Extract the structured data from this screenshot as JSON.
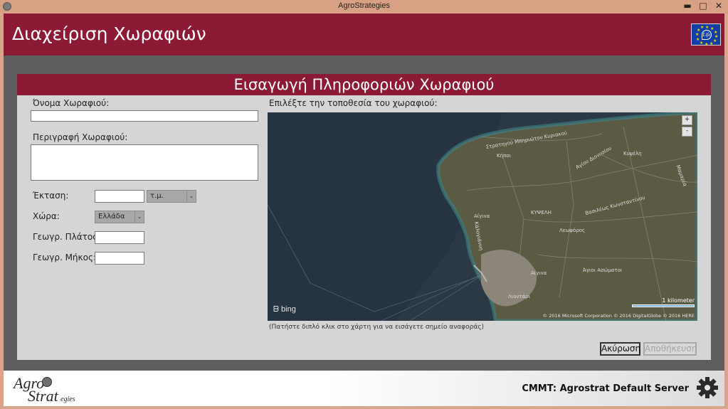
{
  "window": {
    "title": "AgroStrategies",
    "minimize_glyph": "▬",
    "maximize_glyph": "□",
    "close_glyph": "✕"
  },
  "header": {
    "title": "Διαχείριση Χωραφιών",
    "logo_text": "Life"
  },
  "dialog": {
    "title": "Εισαγωγή Πληροφοριών Χωραφιού",
    "fields": {
      "name_label": "Όνομα Χωραφιού:",
      "name_value": "",
      "description_label": "Περιγραφή Χωραφιού:",
      "description_value": "",
      "area_label": "Έκταση:",
      "area_value": "",
      "area_unit": "τ.μ.",
      "country_label": "Χώρα:",
      "country_value": "Ελλάδα",
      "latitude_label": "Γεωγρ. Πλάτος:",
      "latitude_value": "",
      "longitude_label": "Γεωγρ. Μήκος:",
      "longitude_value": ""
    },
    "map": {
      "label": "Επιλέξτε την τοποθεσία του χωραφιού:",
      "zoom_in": "+",
      "zoom_out": "-",
      "provider": "bing",
      "scale_label": "1 kilometer",
      "copyright": "© 2016 Microsoft Corporation   © 2016 DigitalGlobe   © 2016 HERE",
      "place_labels": [
        "Στρατηγού Μπηριώτου Κυριακού",
        "Κήποι",
        "Κυψέλη",
        "Αίγινα",
        "ΚΥΨΕΛΗ",
        "Βασιλέως Κωνσταντίνου",
        "Λεωφόρος",
        "Αίγινα",
        "Άγιοι Ασώματοι",
        "Κάλογιάννη",
        "Λιοντάρι",
        "Αγίου Διονυσίου",
        "Μαμαρία"
      ],
      "hint": "(Πατήστε διπλό κλικ στο χάρτη για να εισάγετε σημείο αναφοράς)"
    },
    "buttons": {
      "cancel": "Ακύρωση",
      "save": "Αποθήκευση"
    }
  },
  "footer": {
    "logo_line1": "Agro",
    "logo_line2": "Strat",
    "logo_line2_suffix": "egies",
    "server": "CMMT: Agrostrat Default Server"
  },
  "colors": {
    "brand": "#8c1a35",
    "titlebar": "#d9a183",
    "content_bg": "#5e5e5e",
    "dialog_bg": "#d5d5d5"
  }
}
